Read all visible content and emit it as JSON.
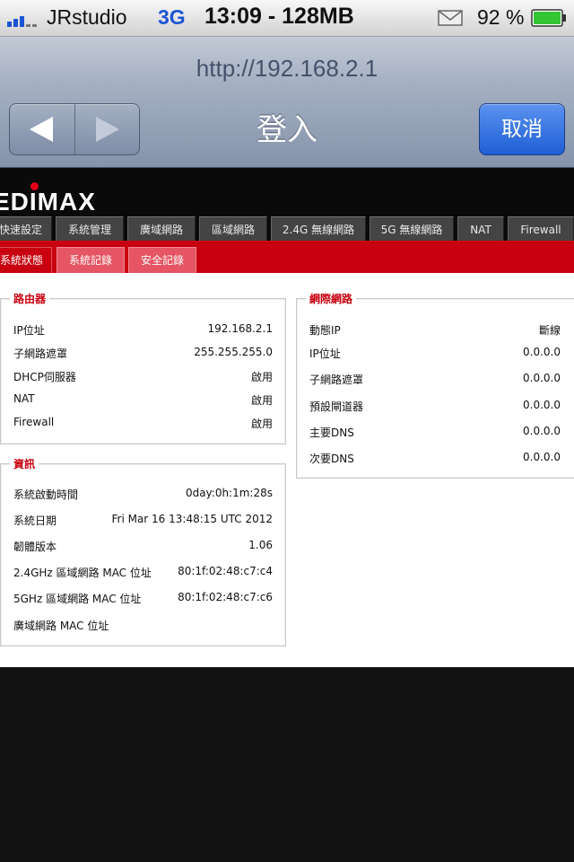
{
  "statusbar": {
    "carrier": "JRstudio",
    "network": "3G",
    "clock_memory": "13:09 - 128MB",
    "battery": "92 %"
  },
  "browser": {
    "url": "http://192.168.2.1",
    "title": "登入",
    "cancel_label": "取消"
  },
  "site": {
    "logo": "EDIMAX",
    "tabs": [
      "快速設定",
      "系統管理",
      "廣域網路",
      "區域網路",
      "2.4G 無線網路",
      "5G 無線網路",
      "NAT",
      "Firewall"
    ],
    "subtabs": [
      "系統狀態",
      "系統記錄",
      "安全記錄"
    ],
    "active_subtab": "系統狀態"
  },
  "router": {
    "legend": "路由器",
    "rows": [
      {
        "label": "IP位址",
        "value": "192.168.2.1"
      },
      {
        "label": "子網路遮罩",
        "value": "255.255.255.0"
      },
      {
        "label": "DHCP伺服器",
        "value": "啟用"
      },
      {
        "label": "NAT",
        "value": "啟用"
      },
      {
        "label": "Firewall",
        "value": "啟用"
      }
    ]
  },
  "info": {
    "legend": "資訊",
    "rows": [
      {
        "label": "系統啟動時間",
        "value": "0day:0h:1m:28s"
      },
      {
        "label": "系統日期",
        "value": "Fri Mar 16 13:48:15 UTC 2012"
      },
      {
        "label": "韌體版本",
        "value": "1.06"
      },
      {
        "label": "2.4GHz 區域網路 MAC 位址",
        "value": "80:1f:02:48:c7:c4"
      },
      {
        "label": "5GHz 區域網路 MAC 位址",
        "value": "80:1f:02:48:c7:c6"
      },
      {
        "label": "廣域網路 MAC 位址",
        "value": ""
      }
    ]
  },
  "internet": {
    "legend": "網際網路",
    "rows": [
      {
        "label": "動態IP",
        "value": "斷線"
      },
      {
        "label": "IP位址",
        "value": "0.0.0.0"
      },
      {
        "label": "子網路遮罩",
        "value": "0.0.0.0"
      },
      {
        "label": "預設閘道器",
        "value": "0.0.0.0"
      },
      {
        "label": "主要DNS",
        "value": "0.0.0.0"
      },
      {
        "label": "次要DNS",
        "value": "0.0.0.0"
      }
    ]
  },
  "colors": {
    "brand_red": "#c8000f",
    "ios_blue": "#1f5ed6"
  },
  "icons": [
    "signal-icon",
    "mail-icon",
    "battery-icon",
    "back-arrow-icon",
    "forward-arrow-icon"
  ]
}
